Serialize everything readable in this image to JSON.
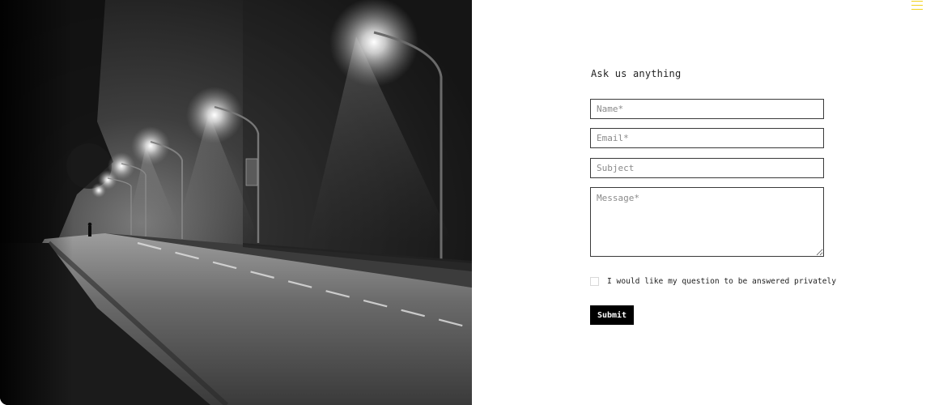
{
  "photo": {
    "subject": "foggy-night-street-with-lamps"
  },
  "menu": {
    "icon": "hamburger-menu-icon",
    "color": "#f2d21c"
  },
  "form": {
    "title": "Ask us anything",
    "fields": {
      "name_placeholder": "Name*",
      "email_placeholder": "Email*",
      "subject_placeholder": "Subject",
      "message_placeholder": "Message*"
    },
    "privacy_checkbox": {
      "label": "I would like my question to be answered privately",
      "checked": false
    },
    "submit_label": "Submit"
  }
}
